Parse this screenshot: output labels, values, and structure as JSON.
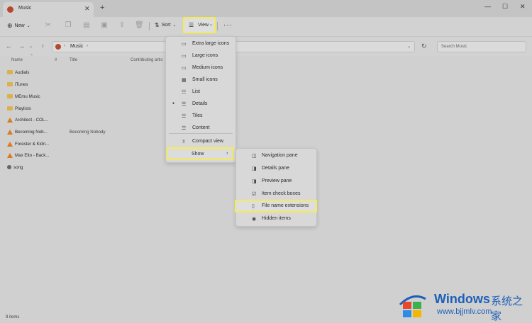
{
  "window": {
    "tab_title": "Music",
    "tab_close": "✕",
    "new_tab": "+",
    "minimize": "—",
    "maximize": "☐",
    "close": "✕"
  },
  "toolbar": {
    "new_label": "New",
    "sort_label": "Sort",
    "view_label": "View",
    "more_label": "···"
  },
  "address": {
    "path_folder": "Music",
    "search_placeholder": "Search Music"
  },
  "columns": [
    "Name",
    "#",
    "Title",
    "Contributing artis"
  ],
  "files": [
    {
      "name": "Audials",
      "kind": "folder",
      "title": ""
    },
    {
      "name": "iTunes",
      "kind": "folder",
      "title": ""
    },
    {
      "name": "MEmu Music",
      "kind": "folder",
      "title": ""
    },
    {
      "name": "Playlists",
      "kind": "folder",
      "title": ""
    },
    {
      "name": "Architect - COL...",
      "kind": "vlc",
      "title": ""
    },
    {
      "name": "Becoming Nob...",
      "kind": "vlc",
      "title": "Becoming Nobody"
    },
    {
      "name": "Forester & Kidn...",
      "kind": "vlc",
      "title": ""
    },
    {
      "name": "Max Elto - Back...",
      "kind": "vlc",
      "title": ""
    },
    {
      "name": "song",
      "kind": "audio",
      "title": ""
    }
  ],
  "status": "9 items",
  "view_menu": {
    "items": [
      {
        "label": "Extra large icons",
        "icon": "monitor-icon"
      },
      {
        "label": "Large icons",
        "icon": "monitor-icon"
      },
      {
        "label": "Medium icons",
        "icon": "monitor-icon"
      },
      {
        "label": "Small icons",
        "icon": "grid-icon"
      },
      {
        "label": "List",
        "icon": "list-icon"
      },
      {
        "label": "Details",
        "icon": "details-icon",
        "selected": true
      },
      {
        "label": "Tiles",
        "icon": "tiles-icon"
      },
      {
        "label": "Content",
        "icon": "content-icon"
      },
      {
        "label": "Compact view",
        "icon": "compact-icon"
      }
    ],
    "show_label": "Show"
  },
  "show_menu": {
    "items": [
      {
        "label": "Navigation pane"
      },
      {
        "label": "Details pane"
      },
      {
        "label": "Preview pane"
      },
      {
        "label": "Item check boxes"
      },
      {
        "label": "File name extensions"
      },
      {
        "label": "Hidden items"
      }
    ]
  },
  "watermark": {
    "brand": "Windows",
    "cn": "系统之家",
    "url": "www.bjjmlv.com"
  },
  "colors": {
    "highlight": "#f4ec52",
    "brand_blue": "#1d5fb8"
  }
}
